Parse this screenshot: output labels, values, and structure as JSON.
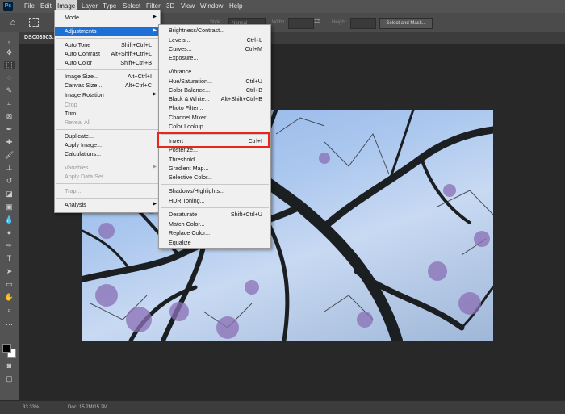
{
  "menubar": {
    "logo": "Ps",
    "items": [
      "File",
      "Edit",
      "Image",
      "Layer",
      "Type",
      "Select",
      "Filter",
      "3D",
      "View",
      "Window",
      "Help"
    ]
  },
  "options": {
    "style_label": "Style:",
    "style_value": "Normal",
    "width_label": "Width:",
    "height_label": "Height:",
    "select_mask": "Select and Mask..."
  },
  "document": {
    "tab": "DSC03503..."
  },
  "image_menu": {
    "items": [
      {
        "label": "Mode",
        "shortcut": "",
        "submenu": true,
        "disabled": false
      },
      {
        "label": "Adjustments",
        "shortcut": "",
        "submenu": true,
        "disabled": false
      },
      {
        "label": "Auto Tone",
        "shortcut": "Shift+Ctrl+L",
        "submenu": false,
        "disabled": false
      },
      {
        "label": "Auto Contrast",
        "shortcut": "Alt+Shift+Ctrl+L",
        "submenu": false,
        "disabled": false
      },
      {
        "label": "Auto Color",
        "shortcut": "Shift+Ctrl+B",
        "submenu": false,
        "disabled": false
      },
      {
        "label": "Image Size...",
        "shortcut": "Alt+Ctrl+I",
        "submenu": false,
        "disabled": false
      },
      {
        "label": "Canvas Size...",
        "shortcut": "Alt+Ctrl+C",
        "submenu": false,
        "disabled": false
      },
      {
        "label": "Image Rotation",
        "shortcut": "",
        "submenu": true,
        "disabled": false
      },
      {
        "label": "Crop",
        "shortcut": "",
        "submenu": false,
        "disabled": true
      },
      {
        "label": "Trim...",
        "shortcut": "",
        "submenu": false,
        "disabled": false
      },
      {
        "label": "Reveal All",
        "shortcut": "",
        "submenu": false,
        "disabled": true
      },
      {
        "label": "Duplicate...",
        "shortcut": "",
        "submenu": false,
        "disabled": false
      },
      {
        "label": "Apply Image...",
        "shortcut": "",
        "submenu": false,
        "disabled": false
      },
      {
        "label": "Calculations...",
        "shortcut": "",
        "submenu": false,
        "disabled": false
      },
      {
        "label": "Variables",
        "shortcut": "",
        "submenu": true,
        "disabled": true
      },
      {
        "label": "Apply Data Set...",
        "shortcut": "",
        "submenu": false,
        "disabled": true
      },
      {
        "label": "Trap...",
        "shortcut": "",
        "submenu": false,
        "disabled": true
      },
      {
        "label": "Analysis",
        "shortcut": "",
        "submenu": true,
        "disabled": false
      }
    ]
  },
  "adjustments_menu": {
    "items": [
      {
        "label": "Brightness/Contrast...",
        "shortcut": ""
      },
      {
        "label": "Levels...",
        "shortcut": "Ctrl+L"
      },
      {
        "label": "Curves...",
        "shortcut": "Ctrl+M"
      },
      {
        "label": "Exposure...",
        "shortcut": ""
      },
      {
        "label": "Vibrance...",
        "shortcut": ""
      },
      {
        "label": "Hue/Saturation...",
        "shortcut": "Ctrl+U"
      },
      {
        "label": "Color Balance...",
        "shortcut": "Ctrl+B"
      },
      {
        "label": "Black & White...",
        "shortcut": "Alt+Shift+Ctrl+B"
      },
      {
        "label": "Photo Filter...",
        "shortcut": ""
      },
      {
        "label": "Channel Mixer...",
        "shortcut": ""
      },
      {
        "label": "Color Lookup...",
        "shortcut": ""
      },
      {
        "label": "Invert",
        "shortcut": "Ctrl+I"
      },
      {
        "label": "Posterize...",
        "shortcut": ""
      },
      {
        "label": "Threshold...",
        "shortcut": ""
      },
      {
        "label": "Gradient Map...",
        "shortcut": ""
      },
      {
        "label": "Selective Color...",
        "shortcut": ""
      },
      {
        "label": "Shadows/Highlights...",
        "shortcut": ""
      },
      {
        "label": "HDR Toning...",
        "shortcut": ""
      },
      {
        "label": "Desaturate",
        "shortcut": "Shift+Ctrl+U"
      },
      {
        "label": "Match Color...",
        "shortcut": ""
      },
      {
        "label": "Replace Color...",
        "shortcut": ""
      },
      {
        "label": "Equalize",
        "shortcut": ""
      }
    ]
  },
  "status": {
    "zoom": "33.33%",
    "doc": "Doc: 15.2M/15.2M"
  },
  "colors": {
    "highlight": "#1e6fd6",
    "callout": "#e8261a"
  }
}
